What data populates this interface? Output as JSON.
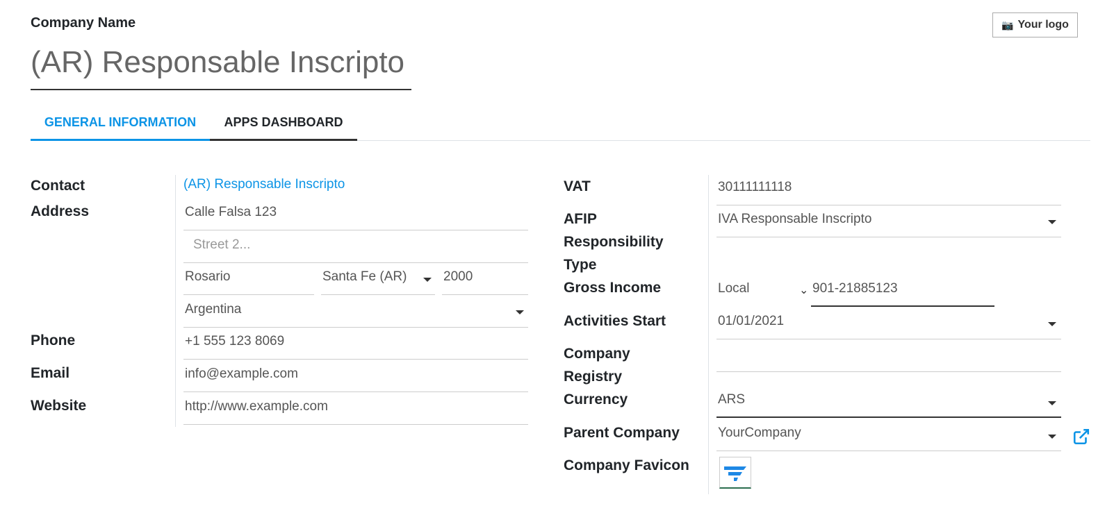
{
  "header": {
    "company_label": "Company Name",
    "company_name": "(AR) Responsable Inscripto",
    "logo_button": "Your logo"
  },
  "tabs": [
    {
      "label": "GENERAL INFORMATION",
      "active": true
    },
    {
      "label": "APPS DASHBOARD",
      "active": false
    }
  ],
  "left": {
    "labels": {
      "contact": "Contact",
      "address": "Address",
      "phone": "Phone",
      "email": "Email",
      "website": "Website"
    },
    "contact_link": "(AR) Responsable Inscripto",
    "street": "Calle Falsa 123",
    "street2_placeholder": "Street 2...",
    "city": "Rosario",
    "state": "Santa Fe (AR)",
    "zip": "2000",
    "country": "Argentina",
    "phone": "+1 555 123 8069",
    "email": "info@example.com",
    "website": "http://www.example.com"
  },
  "right": {
    "labels": {
      "vat": "VAT",
      "afip_1": "AFIP",
      "afip_2": "Responsibility",
      "afip_3": "Type",
      "gross_income": "Gross Income",
      "activities_start": "Activities Start",
      "registry_1": "Company",
      "registry_2": "Registry",
      "currency": "Currency",
      "parent_company": "Parent Company",
      "favicon": "Company Favicon"
    },
    "vat": "30111111118",
    "afip_type": "IVA Responsable Inscripto",
    "gross_income_type": "Local",
    "gross_income_number": "901-21885123",
    "activities_start": "01/01/2021",
    "company_registry": "",
    "currency": "ARS",
    "parent_company": "YourCompany"
  },
  "colors": {
    "accent": "#0c94e6",
    "text": "#212529",
    "favicon_blue": "#1e88e5",
    "favicon_green": "#2b6e4f"
  }
}
